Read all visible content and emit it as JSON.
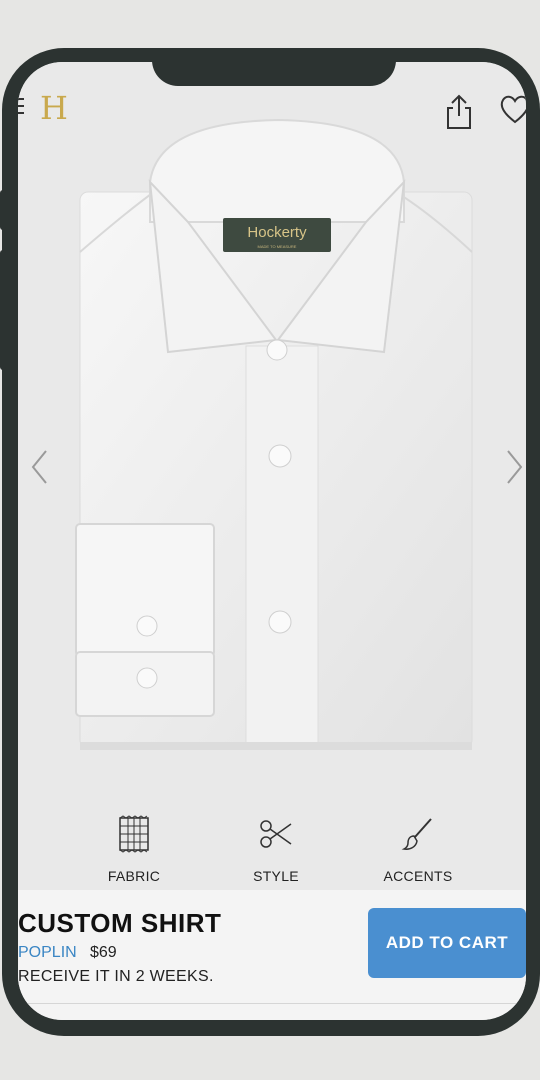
{
  "header": {
    "logo_text": "H",
    "menu_icon": "hamburger-icon",
    "share_icon": "share-icon",
    "favorite_icon": "heart-icon"
  },
  "product_image": {
    "label_text": "Hockerty",
    "label_subtext": "MADE TO MEASURE"
  },
  "options": [
    {
      "label": "FABRIC",
      "icon": "fabric-swatch-icon"
    },
    {
      "label": "STYLE",
      "icon": "scissors-icon"
    },
    {
      "label": "ACCENTS",
      "icon": "brush-icon"
    }
  ],
  "product": {
    "title": "CUSTOM SHIRT",
    "fabric": "POPLIN",
    "price": "$69",
    "delivery": "RECEIVE IT IN 2 WEEKS."
  },
  "cart": {
    "label": "ADD TO CART"
  },
  "colors": {
    "accent": "#4a8fd0",
    "logo_gold": "#c9a94d",
    "fabric_link": "#3b86c4",
    "frame": "#2c3331"
  }
}
